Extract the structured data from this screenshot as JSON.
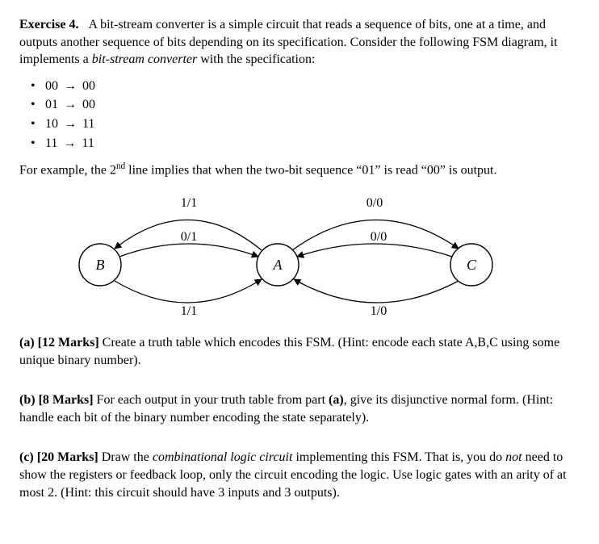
{
  "exercise": {
    "label": "Exercise 4.",
    "intro": "A bit-stream converter is a simple circuit that reads a sequence of bits, one at a time, and outputs another sequence of bits depending on its specification. Consider the following FSM diagram, it implements a ",
    "intro_italic": "bit-stream converter",
    "intro_tail": " with the specification:"
  },
  "spec": {
    "items": [
      {
        "lhs": "00",
        "rhs": "00"
      },
      {
        "lhs": "01",
        "rhs": "00"
      },
      {
        "lhs": "10",
        "rhs": "11"
      },
      {
        "lhs": "11",
        "rhs": "11"
      }
    ]
  },
  "example": {
    "pre": "For example, the 2",
    "sup": "nd",
    "mid": " line implies that when the two-bit sequence “01” is read “00” is output."
  },
  "fsm": {
    "states": {
      "A": "A",
      "B": "B",
      "C": "C"
    },
    "edges": {
      "top_left": "1/1",
      "mid_left": "0/1",
      "bot_left": "1/1",
      "top_right": "0/0",
      "mid_right": "0/0",
      "bot_right": "1/0"
    }
  },
  "parts": {
    "a": {
      "label": "(a)",
      "marks": "[12 Marks]",
      "text": " Create a truth table which encodes this FSM. (Hint: encode each state A,B,C using some unique binary number)."
    },
    "b": {
      "label": "(b)",
      "marks": "[8 Marks]",
      "text_pre": " For each output in your truth table from part ",
      "text_bold": "(a)",
      "text_post": ", give its disjunctive normal form. (Hint: handle each bit of the binary number encoding the state separately)."
    },
    "c": {
      "label": "(c)",
      "marks": "[20 Marks]",
      "text_pre": " Draw the ",
      "text_italic": "combinational logic circuit",
      "text_mid": " implementing this FSM. That is, you do ",
      "text_not": "not",
      "text_post": " need to show the registers or feedback loop, only the circuit encoding the logic. Use logic gates with an arity of at most 2. (Hint: this circuit should have 3 inputs and 3 outputs)."
    }
  }
}
